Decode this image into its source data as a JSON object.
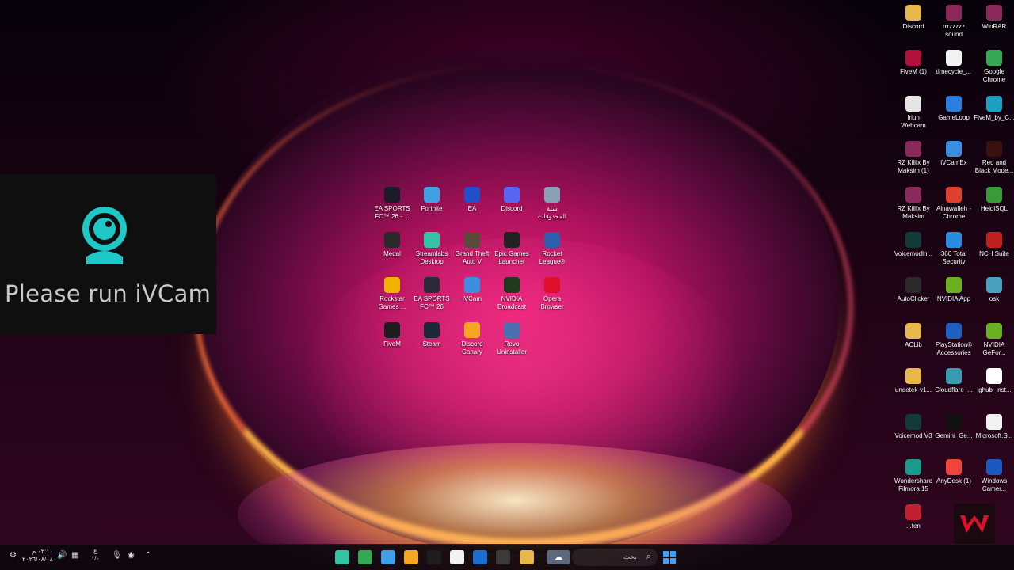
{
  "desktop": {
    "center_icons": [
      {
        "label": "EA SPORTS\nFC™ 26 - ...",
        "icon": "ea-fc-icon",
        "color": "#1b1b2a"
      },
      {
        "label": "Fortnite",
        "icon": "fortnite-icon",
        "color": "#3fa0e6"
      },
      {
        "label": "EA",
        "icon": "ea-icon",
        "color": "#2350c8"
      },
      {
        "label": "Discord",
        "icon": "discord-icon",
        "color": "#5865f2"
      },
      {
        "label": "سلة\nالمحذوفات",
        "icon": "recycle-bin-icon",
        "color": "#8aa0b6"
      },
      {
        "label": "Medal",
        "icon": "medal-icon",
        "color": "#2a2a2a"
      },
      {
        "label": "Streamlabs\nDesktop",
        "icon": "streamlabs-icon",
        "color": "#31c3a2"
      },
      {
        "label": "Grand Theft\nAuto V",
        "icon": "gta-icon",
        "color": "#5a4a3a"
      },
      {
        "label": "Epic Games\nLauncher",
        "icon": "epic-games-icon",
        "color": "#222222"
      },
      {
        "label": "Rocket\nLeague®",
        "icon": "rocket-league-icon",
        "color": "#2a5fb0"
      },
      {
        "label": "Rockstar\nGames ...",
        "icon": "rockstar-icon",
        "color": "#f0b400"
      },
      {
        "label": "EA SPORTS\nFC™ 26",
        "icon": "ea-fc-icon",
        "color": "#2a2a3a"
      },
      {
        "label": "iVCam",
        "icon": "ivcam-icon",
        "color": "#3a8fe0"
      },
      {
        "label": "NVIDIA\nBroadcast",
        "icon": "nvidia-broadcast-icon",
        "color": "#1f3a1f"
      },
      {
        "label": "Opera\nBrowser",
        "icon": "opera-icon",
        "color": "#e0102a"
      },
      {
        "label": "FiveM",
        "icon": "fivem-icon",
        "color": "#1d1d1d"
      },
      {
        "label": "Steam",
        "icon": "steam-icon",
        "color": "#1b2838"
      },
      {
        "label": "Discord\nCanary",
        "icon": "discord-canary-icon",
        "color": "#f5a623"
      },
      {
        "label": "Revo\nUninstaller",
        "icon": "revo-uninstaller-icon",
        "color": "#4a70b0"
      }
    ],
    "right_icons": [
      {
        "label": "Discord",
        "icon": "folder-icon",
        "color": "#e8b84a"
      },
      {
        "label": "rrrzzzzz\nsound",
        "icon": "winrar-archive-icon",
        "color": "#8b2a5a"
      },
      {
        "label": "WinRAR",
        "icon": "winrar-icon",
        "color": "#8b2a5a"
      },
      {
        "label": "FiveM (1)",
        "icon": "fivem-icon",
        "color": "#b0103a"
      },
      {
        "label": "timecycle_...",
        "icon": "file-icon",
        "color": "#f2f2f2"
      },
      {
        "label": "Google\nChrome",
        "icon": "chrome-icon",
        "color": "#34a853"
      },
      {
        "label": "Iriun\nWebcam",
        "icon": "iriun-webcam-icon",
        "color": "#e6e6e6"
      },
      {
        "label": "GameLoop",
        "icon": "gameloop-icon",
        "color": "#2a7fe0"
      },
      {
        "label": "FiveM_by_C...",
        "icon": "edge-icon",
        "color": "#1aa0c0"
      },
      {
        "label": "RZ Killfx By\nMaksim (1)",
        "icon": "winrar-archive-icon",
        "color": "#8b2a5a"
      },
      {
        "label": "iVCamEx",
        "icon": "ivcam-icon",
        "color": "#3a8fe0"
      },
      {
        "label": "Red and\nBlack Mode...",
        "icon": "video-file-icon",
        "color": "#3a1010"
      },
      {
        "label": "RZ Killfx By\nMaksim",
        "icon": "winrar-archive-icon",
        "color": "#8b2a5a"
      },
      {
        "label": "Alnawafleh -\nChrome",
        "icon": "chrome-icon",
        "color": "#e04030"
      },
      {
        "label": "HeidiSQL",
        "icon": "heidisql-icon",
        "color": "#3a9a3a"
      },
      {
        "label": "Voicemodln...",
        "icon": "voicemod-icon",
        "color": "#123a3a"
      },
      {
        "label": "360 Total\nSecurity",
        "icon": "360-security-icon",
        "color": "#2a8ae0"
      },
      {
        "label": "NCH Suite",
        "icon": "nch-suite-icon",
        "color": "#c02020"
      },
      {
        "label": "AutoClicker",
        "icon": "autoclicker-icon",
        "color": "#2a2a2a"
      },
      {
        "label": "NVIDIA App",
        "icon": "nvidia-icon",
        "color": "#6ab020"
      },
      {
        "label": "osk",
        "icon": "keyboard-icon",
        "color": "#4aa0c0"
      },
      {
        "label": "ACLib",
        "icon": "folder-icon",
        "color": "#e8b84a"
      },
      {
        "label": "PlayStation®\nAccessories",
        "icon": "playstation-icon",
        "color": "#1f5fc0"
      },
      {
        "label": "NVIDIA\nGeFor...",
        "icon": "nvidia-icon",
        "color": "#6ab020"
      },
      {
        "label": "undetek-v1...",
        "icon": "folder-icon",
        "color": "#e8b84a"
      },
      {
        "label": "Cloudflare_...",
        "icon": "installer-icon",
        "color": "#3a9ab0"
      },
      {
        "label": "lghub_inst...",
        "icon": "logitech-icon",
        "color": "#ffffff"
      },
      {
        "label": "Voicemod V3",
        "icon": "voicemod-icon",
        "color": "#123a3a"
      },
      {
        "label": "Gemini_Ge...",
        "icon": "black-file-icon",
        "color": "#111111"
      },
      {
        "label": "Microsoft.S...",
        "icon": "file-icon",
        "color": "#f2f2f2"
      },
      {
        "label": "Wondershare\nFilmora 15",
        "icon": "filmora-icon",
        "color": "#1a9a8a"
      },
      {
        "label": "AnyDesk (1)",
        "icon": "anydesk-icon",
        "color": "#ef443b"
      },
      {
        "label": "Windows\nCamer...",
        "icon": "windows-camera-icon",
        "color": "#1a5ac0"
      },
      {
        "label": "...ten",
        "icon": "app-icon",
        "color": "#c02030"
      }
    ]
  },
  "ivcam_overlay": {
    "message": "Please run iVCam",
    "accent": "#1fc7c7"
  },
  "taskbar": {
    "clock_time": "٠٢:١٠ م",
    "clock_date": "٢٠٢٦/٠٨/٠٨",
    "lang": "ع",
    "lang_sub": "١/٠",
    "search_placeholder": "بحث",
    "pinned": [
      {
        "icon": "streamlabs-icon",
        "color": "#31c3a2"
      },
      {
        "icon": "chrome-icon",
        "color": "#34a853"
      },
      {
        "icon": "fortnite-icon",
        "color": "#3fa0e6"
      },
      {
        "icon": "discord-canary-icon",
        "color": "#f5a623"
      },
      {
        "icon": "fivem-icon",
        "color": "#1d1d1d"
      },
      {
        "icon": "file-icon",
        "color": "#f2f2f2"
      },
      {
        "icon": "outlook-icon",
        "color": "#1a6fd0"
      },
      {
        "icon": "store-icon",
        "color": "#3a3a3a"
      },
      {
        "icon": "folder-icon",
        "color": "#e8b84a"
      }
    ]
  }
}
